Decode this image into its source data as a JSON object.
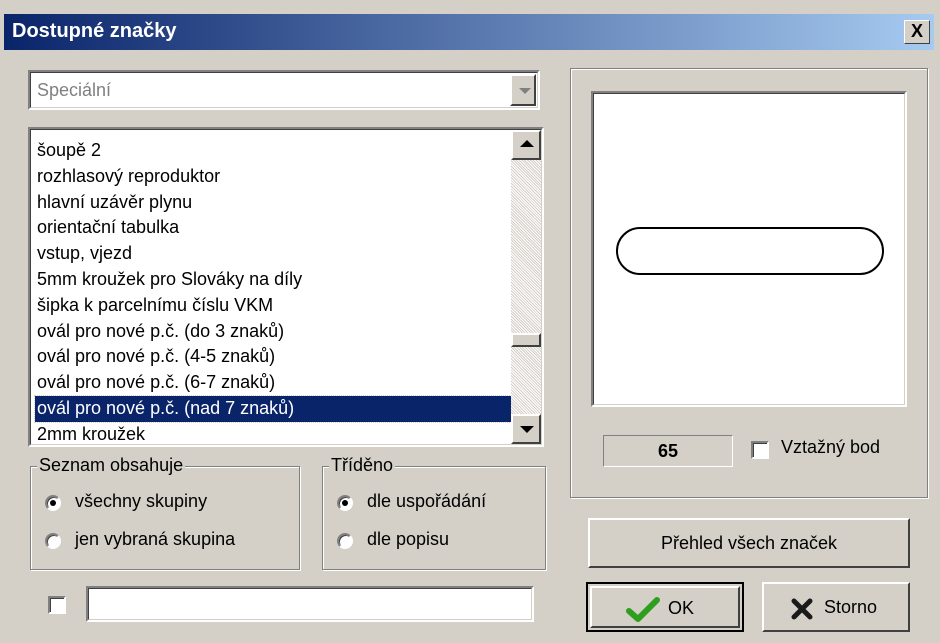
{
  "window": {
    "title": "Dostupné značky",
    "close_label": "X"
  },
  "combo": {
    "value": "Speciální"
  },
  "list": {
    "items": [
      "šoupě 2",
      "rozhlasový reproduktor",
      "hlavní uzávěr plynu",
      "orientační tabulka",
      "vstup, vjezd",
      "5mm kroužek pro Slováky na díly",
      "šipka k parcelnímu číslu VKM",
      "ovál pro nové p.č. (do 3 znaků)",
      "ovál pro nové p.č. (4-5 znaků)",
      "ovál pro nové p.č. (6-7 znaků)",
      "ovál pro nové p.č. (nad 7 znaků)",
      "2mm kroužek"
    ],
    "selected_index": 10
  },
  "group_contains": {
    "label": "Seznam obsahuje",
    "options": [
      "všechny skupiny",
      "jen vybraná skupina"
    ],
    "selected": 0
  },
  "group_sorted": {
    "label": "Tříděno",
    "options": [
      "dle uspořádání",
      "dle popisu"
    ],
    "selected": 0
  },
  "preview": {
    "number": "65",
    "reference_label": "Vztažný bod",
    "reference_checked": false
  },
  "filter": {
    "checked": false,
    "value": ""
  },
  "buttons": {
    "overview": "Přehled všech značek",
    "ok": "OK",
    "cancel": "Storno"
  },
  "colors": {
    "title_gradient_start": "#0a246a",
    "title_gradient_end": "#a6caf0",
    "selection": "#0a246a",
    "face": "#d4d0c8",
    "ok_check": "#2e9e1f",
    "cancel_x": "#1a1a1a"
  },
  "icons": {
    "ok": "check-icon",
    "cancel": "x-icon",
    "close": "close-icon"
  }
}
